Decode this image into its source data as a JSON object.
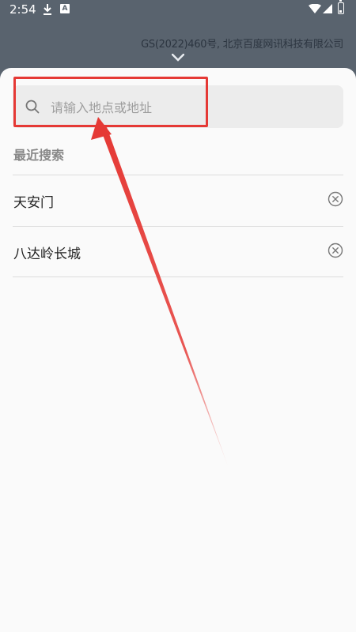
{
  "status_bar": {
    "time": "2:54",
    "icons": [
      "download-icon",
      "a-icon",
      "wifi-icon",
      "signal-icon",
      "battery-icon"
    ],
    "a_icon_text": "A"
  },
  "map": {
    "copyright": "GS(2022)460号, 北京百度网讯科技有限公司",
    "collapse_icon": "chevron-down-icon"
  },
  "search": {
    "placeholder": "请输入地点或地址",
    "value": "",
    "icon": "search-icon"
  },
  "recent": {
    "title": "最近搜索",
    "items": [
      {
        "label": "天安门",
        "action_icon": "clear-icon"
      },
      {
        "label": "八达岭长城",
        "action_icon": "clear-icon"
      }
    ]
  },
  "annotation": {
    "color": "#e53935",
    "target": "search-box"
  },
  "colors": {
    "status_bar_bg": "#59636e",
    "sheet_bg": "#fafafa",
    "search_bg": "#ececec",
    "accent_red": "#e53935"
  }
}
